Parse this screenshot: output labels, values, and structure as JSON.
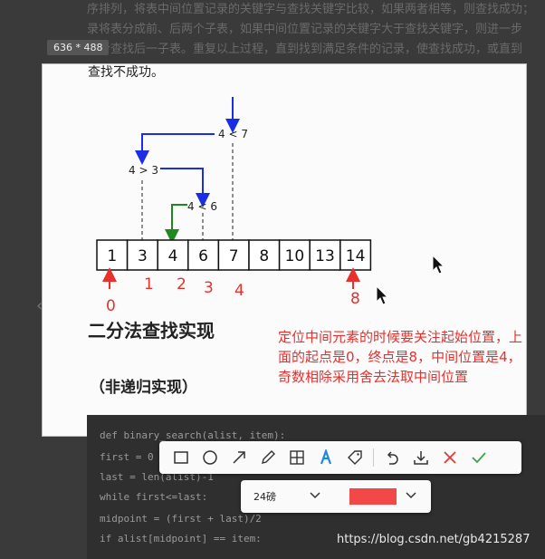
{
  "background": {
    "text_lines": [
      "序排列，将表中间位置记录的关键字与查找关键字比较，如果两者相等，则查找成功；",
      "录将表分成前、后两个子表，如果中间位置记录的关键字大于查找关键字，则进一步",
      "一步查找后一子表。重复以上过程，直到找到满足条件的记录，使查找成功，或直到"
    ],
    "size_badge": "636 * 488"
  },
  "screenshot": {
    "top_text": "查找不成功。",
    "array_values": [
      "1",
      "3",
      "4",
      "6",
      "7",
      "8",
      "10",
      "13",
      "14"
    ],
    "index_labels": [
      "0",
      "1",
      "2",
      "3",
      "4",
      "8"
    ],
    "comparisons": [
      "4 < 7",
      "4 > 3",
      "4 < 6"
    ],
    "heading_main": "二分法查找实现",
    "heading_sub": "（非递归实现）",
    "note": "定位中间元素的时候要关注起始位置，上面的起点是0，终点是8，中间位置是4，奇数相除采用舍去法取中间位置"
  },
  "code_lines": [
    "def binary_search(alist, item):",
    "    first = 0",
    "    last = len(alist)-1",
    "    while first<=last:",
    "        midpoint = (first + last)/2",
    "        if alist[midpoint] == item:"
  ],
  "toolbar": {
    "tools": [
      "rectangle-icon",
      "ellipse-icon",
      "arrow-icon",
      "pen-icon",
      "mosaic-icon",
      "text-icon",
      "tag-icon",
      "undo-icon",
      "download-icon",
      "cancel-icon",
      "confirm-icon"
    ]
  },
  "subbar": {
    "font_size": "24磅",
    "color": "#f24848"
  },
  "colors": {
    "blue": "#1a2ee6",
    "green": "#1e8a1e",
    "red": "#e8302d"
  },
  "watermark": "https://blog.csdn.net/gb4215287"
}
